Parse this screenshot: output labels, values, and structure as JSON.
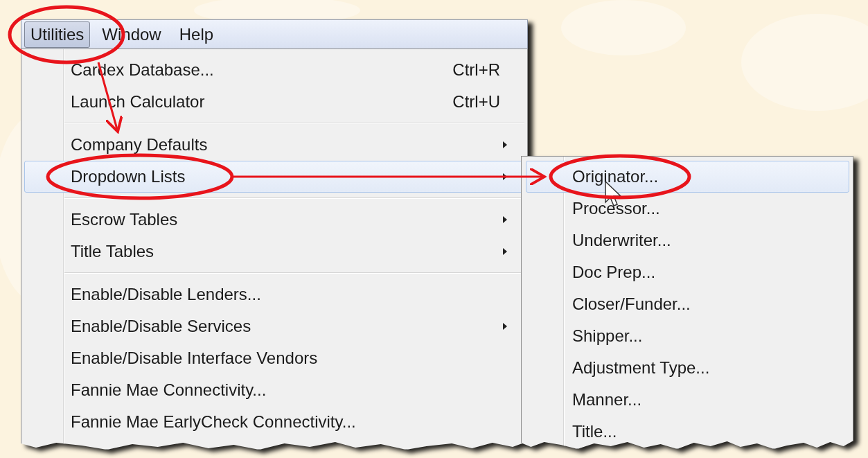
{
  "menu_bar": [
    {
      "label": "Utilities",
      "selected": true
    },
    {
      "label": "Window",
      "selected": false
    },
    {
      "label": "Help",
      "selected": false
    }
  ],
  "utilities_menu": {
    "items": [
      {
        "kind": "item",
        "label": "Cardex Database...",
        "shortcut": "Ctrl+R",
        "submenu": false,
        "selected": false
      },
      {
        "kind": "item",
        "label": "Launch Calculator",
        "shortcut": "Ctrl+U",
        "submenu": false,
        "selected": false
      },
      {
        "kind": "separator"
      },
      {
        "kind": "item",
        "label": "Company Defaults",
        "submenu": true,
        "selected": false
      },
      {
        "kind": "item",
        "label": "Dropdown Lists",
        "submenu": true,
        "selected": true
      },
      {
        "kind": "separator"
      },
      {
        "kind": "item",
        "label": "Escrow Tables",
        "submenu": true,
        "selected": false
      },
      {
        "kind": "item",
        "label": "Title Tables",
        "submenu": true,
        "selected": false
      },
      {
        "kind": "separator"
      },
      {
        "kind": "item",
        "label": "Enable/Disable Lenders...",
        "submenu": false,
        "selected": false
      },
      {
        "kind": "item",
        "label": "Enable/Disable Services",
        "submenu": true,
        "selected": false
      },
      {
        "kind": "item",
        "label": "Enable/Disable Interface Vendors",
        "submenu": false,
        "selected": false
      },
      {
        "kind": "item",
        "label": "Fannie Mae Connectivity...",
        "submenu": false,
        "selected": false
      },
      {
        "kind": "item",
        "label": "Fannie Mae EarlyCheck Connectivity...",
        "submenu": false,
        "selected": false
      }
    ]
  },
  "dropdown_lists_submenu": {
    "items": [
      {
        "label": "Originator...",
        "selected": true
      },
      {
        "label": "Processor...",
        "selected": false
      },
      {
        "label": "Underwriter...",
        "selected": false
      },
      {
        "label": "Doc Prep...",
        "selected": false
      },
      {
        "label": "Closer/Funder...",
        "selected": false
      },
      {
        "label": "Shipper...",
        "selected": false
      },
      {
        "label": "Adjustment Type...",
        "selected": false
      },
      {
        "label": "Manner...",
        "selected": false
      },
      {
        "label": "Title...",
        "selected": false
      }
    ]
  }
}
